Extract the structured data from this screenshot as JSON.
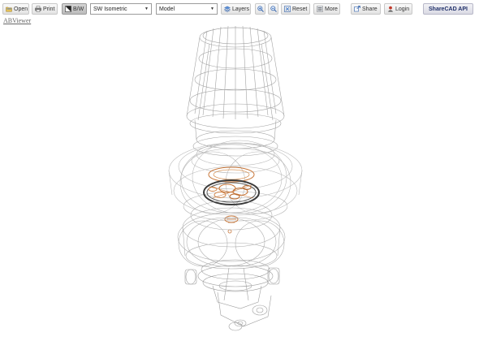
{
  "toolbar": {
    "open_label": "Open",
    "print_label": "Print",
    "bw_label": "B/W",
    "view_select": {
      "value": "SW Isometric"
    },
    "layout_select": {
      "value": "Model"
    },
    "layers_label": "Layers",
    "reset_label": "Reset",
    "more_label": "More",
    "share_label": "Share",
    "login_label": "Login",
    "api_label": "ShareCAD API"
  },
  "header": {
    "brand_link": "ABViewer"
  },
  "colors": {
    "wireframe": "#9e9e9e",
    "wireframe_light": "#c4c4c4",
    "copper": "#c8773a",
    "dark_ring": "#3a3a3a",
    "button_active": "#c8c8c8"
  },
  "icons": {
    "open": "folder-icon",
    "print": "printer-icon",
    "bw": "bw-toggle-icon",
    "layers": "layers-icon",
    "zoom_in": "zoom-in-icon",
    "zoom_out": "zoom-out-icon",
    "reset": "reset-icon",
    "more": "more-icon",
    "share": "share-icon",
    "login": "login-icon"
  }
}
